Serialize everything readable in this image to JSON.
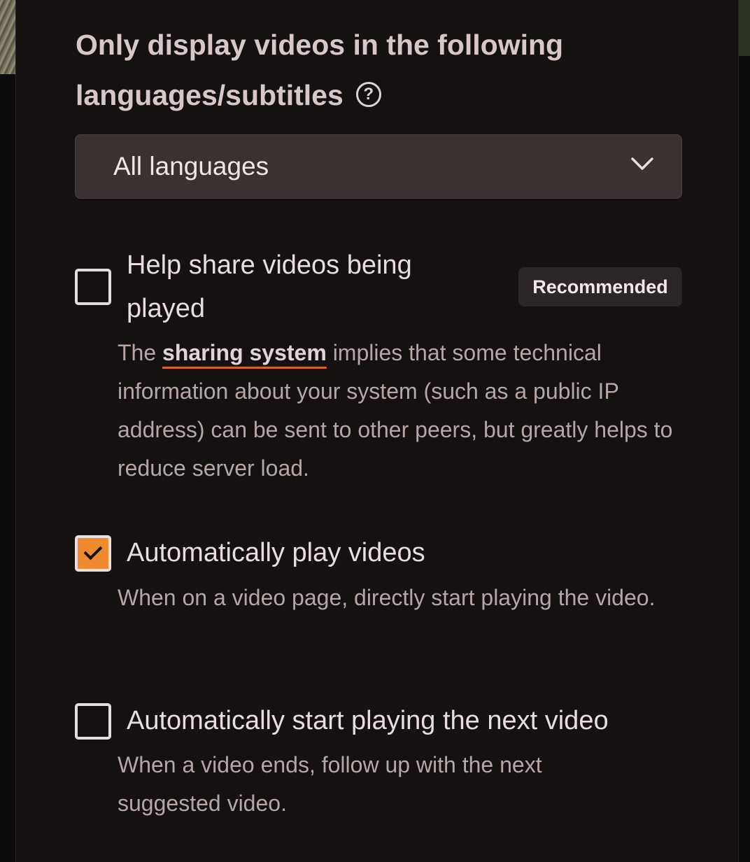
{
  "languages": {
    "heading": "Only display videos in the following languages/subtitles",
    "help_icon": "help-circle-icon",
    "help_glyph": "?",
    "select_value": "All languages",
    "select_icon": "chevron-down-icon"
  },
  "p2p": {
    "label": "Help share videos being played",
    "badge": "Recommended",
    "checked": false,
    "desc_before": "The ",
    "desc_link": "sharing system",
    "desc_after": " implies that some technical information about your system (such as a public IP address) can be sent to other peers, but greatly helps to reduce server load."
  },
  "autoplay": {
    "label": "Automatically play videos",
    "checked": true,
    "desc": "When on a video page, directly start playing the video."
  },
  "autoplay_next": {
    "label": "Automatically start playing the next video",
    "checked": false,
    "desc": "When a video ends, follow up with the next suggested video."
  },
  "colors": {
    "accent": "#f08a2e",
    "link_underline": "#d9641a",
    "panel_bg": "#151111",
    "select_bg": "#3c3131"
  }
}
